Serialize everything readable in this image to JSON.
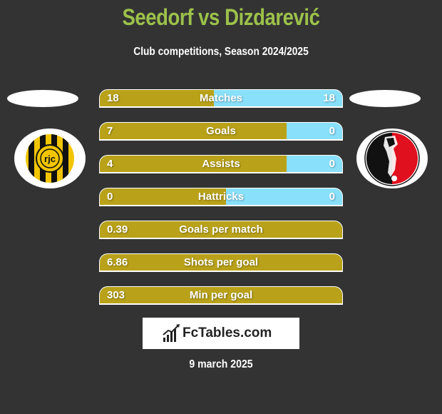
{
  "header": {
    "title": "Seedorf vs Dizdarević",
    "subtitle": "Club competitions, Season 2024/2025"
  },
  "players": {
    "left": {
      "name": "Seedorf",
      "club_logo": "roda-jc-kerkrade-logo"
    },
    "right": {
      "name": "Dizdarević",
      "club_logo": "helmond-sport-logo"
    }
  },
  "colors": {
    "left": "#b9a219",
    "right": "#89e0fb",
    "title": "#9cc14a",
    "background": "#333333"
  },
  "stats": [
    {
      "label": "Matches",
      "left": "18",
      "right": "18",
      "left_share": 0.47
    },
    {
      "label": "Goals",
      "left": "7",
      "right": "0",
      "left_share": 0.77
    },
    {
      "label": "Assists",
      "left": "4",
      "right": "0",
      "left_share": 0.77
    },
    {
      "label": "Hattricks",
      "left": "0",
      "right": "0",
      "left_share": 0.52
    },
    {
      "label": "Goals per match",
      "left": "0.39",
      "right": "",
      "left_share": 1
    },
    {
      "label": "Shots per goal",
      "left": "6.86",
      "right": "",
      "left_share": 1
    },
    {
      "label": "Min per goal",
      "left": "303",
      "right": "",
      "left_share": 1
    }
  ],
  "footer": {
    "brand": "FcTables.com",
    "date": "9 march 2025"
  }
}
